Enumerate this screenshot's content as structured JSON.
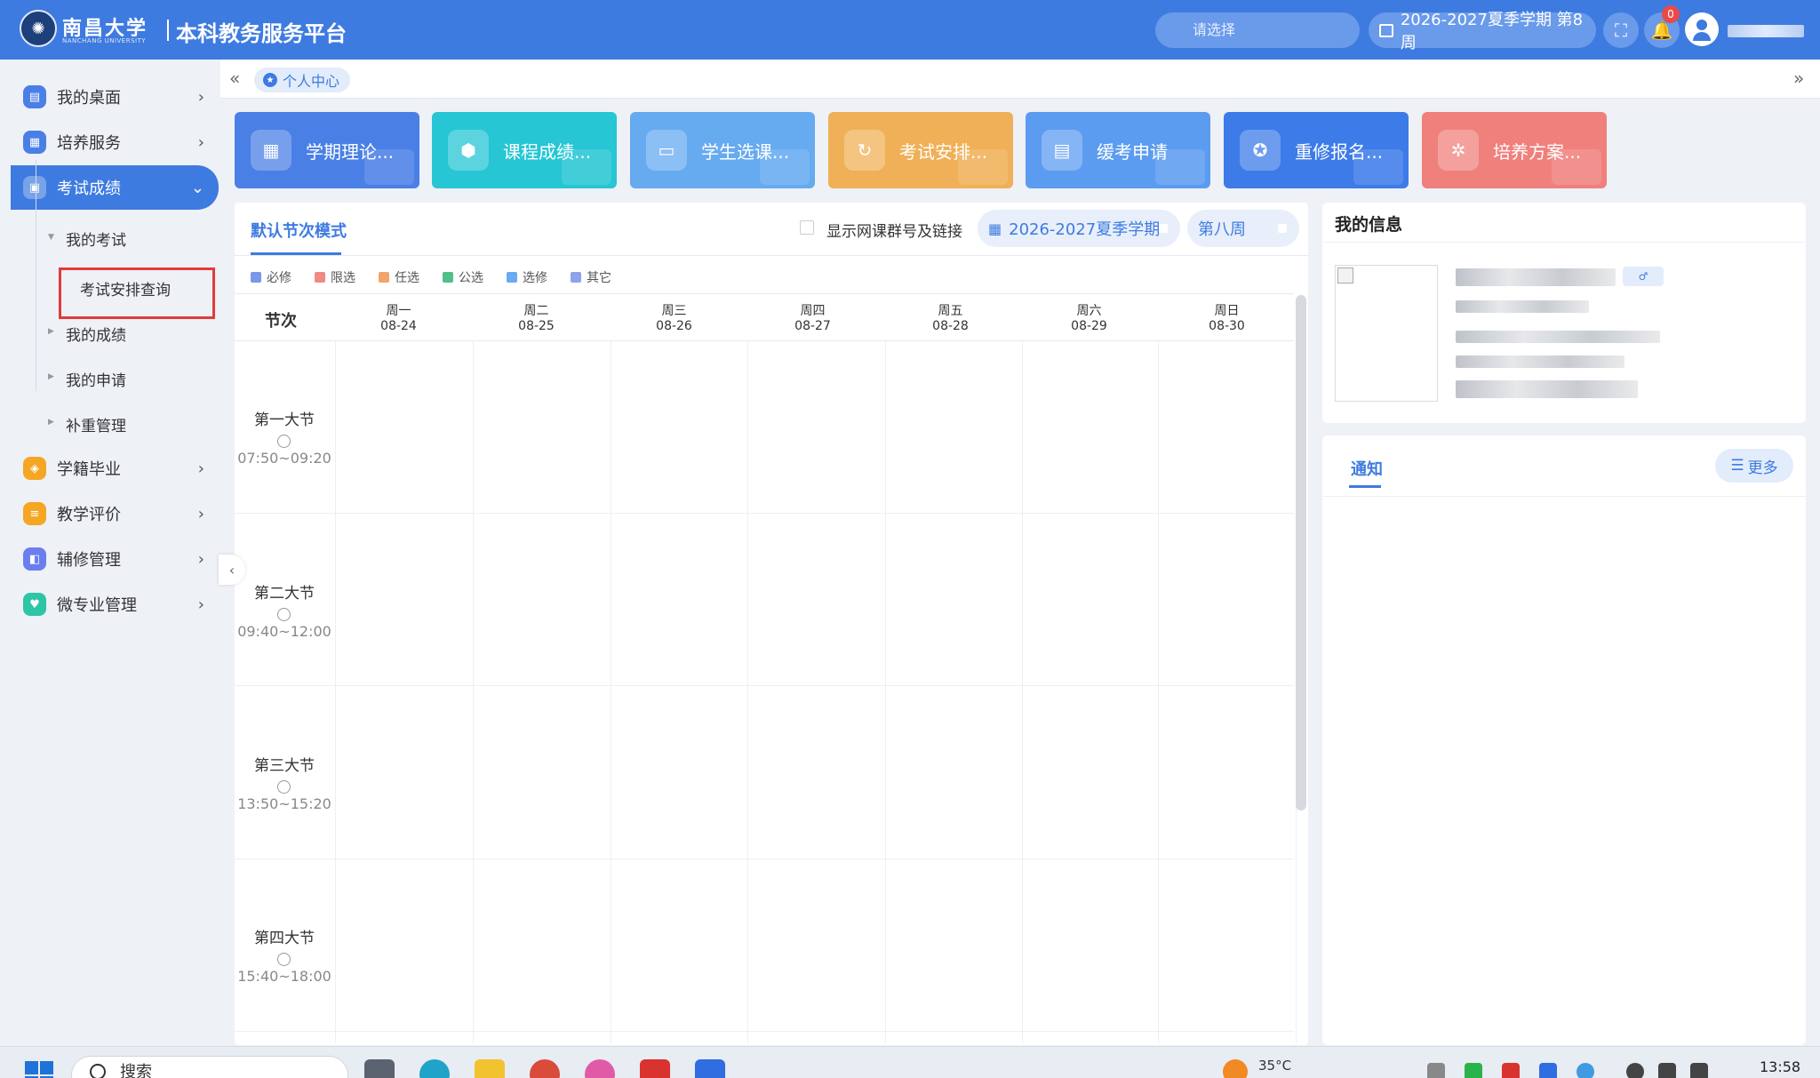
{
  "header": {
    "university_name": "南昌大学",
    "university_sub": "NANCHANG UNIVERSITY",
    "platform_title": "本科教务服务平台",
    "select_placeholder": "请选择",
    "term_label": "2026-2027夏季学期 第8周",
    "notification_count": "0"
  },
  "sidebar": {
    "items": [
      {
        "label": "我的桌面",
        "color": "#4a7fe6"
      },
      {
        "label": "培养服务",
        "color": "#4a7fe6"
      },
      {
        "label": "考试成绩",
        "color": "#ffffff"
      },
      {
        "label": "学籍毕业",
        "color": "#f5a623"
      },
      {
        "label": "教学评价",
        "color": "#f5a623"
      },
      {
        "label": "辅修管理",
        "color": "#6a7ef0"
      },
      {
        "label": "微专业管理",
        "color": "#2ec4a6"
      }
    ],
    "sub_items": [
      "我的考试",
      "考试安排查询",
      "我的成绩",
      "我的申请",
      "补重管理"
    ]
  },
  "breadcrumb": {
    "label": "个人中心"
  },
  "quick_cards": [
    {
      "label": "学期理论...",
      "color": "#4a7fe6"
    },
    {
      "label": "课程成绩...",
      "color": "#26c6d4"
    },
    {
      "label": "学生选课...",
      "color": "#66aaf0"
    },
    {
      "label": "考试安排...",
      "color": "#f0b057"
    },
    {
      "label": "缓考申请",
      "color": "#5c9cf0"
    },
    {
      "label": "重修报名...",
      "color": "#3d7be8"
    },
    {
      "label": "培养方案...",
      "color": "#f0807c"
    }
  ],
  "schedule": {
    "tab": "默认节次模式",
    "checkbox_label": "显示网课群号及链接",
    "term_pill": "2026-2027夏季学期",
    "week_pill": "第八周",
    "legend": [
      {
        "label": "必修",
        "color": "#7b97e8"
      },
      {
        "label": "限选",
        "color": "#f08a84"
      },
      {
        "label": "任选",
        "color": "#f2a56a"
      },
      {
        "label": "公选",
        "color": "#4fc08a"
      },
      {
        "label": "选修",
        "color": "#6aaaf0"
      },
      {
        "label": "其它",
        "color": "#8fa2ea"
      }
    ],
    "period_header": "节次",
    "days": [
      {
        "name": "周一",
        "date": "08-24"
      },
      {
        "name": "周二",
        "date": "08-25"
      },
      {
        "name": "周三",
        "date": "08-26"
      },
      {
        "name": "周四",
        "date": "08-27"
      },
      {
        "name": "周五",
        "date": "08-28"
      },
      {
        "name": "周六",
        "date": "08-29"
      },
      {
        "name": "周日",
        "date": "08-30"
      }
    ],
    "periods": [
      {
        "name": "第一大节",
        "time": "07:50~09:20"
      },
      {
        "name": "第二大节",
        "time": "09:40~12:00"
      },
      {
        "name": "第三大节",
        "time": "13:50~15:20"
      },
      {
        "name": "第四大节",
        "time": "15:40~18:00"
      }
    ]
  },
  "info": {
    "title": "我的信息"
  },
  "notice": {
    "tab": "通知",
    "more": "更多"
  },
  "taskbar": {
    "search": "搜索",
    "temperature": "35°C",
    "time": "13:58"
  }
}
